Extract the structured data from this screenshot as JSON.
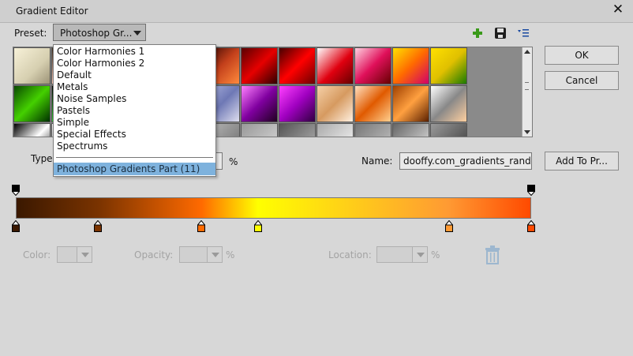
{
  "window": {
    "title": "Gradient Editor",
    "close_glyph": "✕"
  },
  "preset": {
    "label": "Preset:",
    "selected": "Photoshop Gr...",
    "icons": [
      "add-icon",
      "save-icon",
      "menu-list-icon"
    ]
  },
  "swatches": {
    "rows": [
      [
        "linear-gradient(135deg,#f7f1d8,#d6cfb0 60%,#9c9377)",
        "linear-gradient(135deg,#3b2a1a,#fcb,#fff)",
        "linear-gradient(135deg,#1a2f6b,#5c7ed1,#e5ecff)",
        "linear-gradient(135deg,#2a2a2a,#999,#fff)",
        "linear-gradient(135deg,#a00000,#ffea00,#ff6a00)",
        "linear-gradient(135deg,#2b0000,#c3401b,#ff8a3c)",
        "linear-gradient(135deg,#5a0000,#e60000,#300000)",
        "linear-gradient(135deg,#480000,#ff0000,#6b0000)",
        "linear-gradient(135deg,#fff,#e00010 55%,#600)",
        "linear-gradient(135deg,#ffd0e0,#e0105a,#600)",
        "linear-gradient(135deg,#ffe000,#ff6a00,#d0006a)",
        "linear-gradient(135deg,#ffe000,#e0c000,#1a7a00)"
      ],
      [
        "linear-gradient(135deg,#0a4a00,#44d000,#003000)",
        "linear-gradient(135deg,#000,#33cc33,#fff)",
        "linear-gradient(135deg,#fff,#999,#000)",
        "linear-gradient(135deg,#ddd,#555,#eee)",
        "linear-gradient(135deg,#000,#1c5cd6,#9ec6ff)",
        "linear-gradient(135deg,#b0b7e0,#6e78b5,#dde)",
        "linear-gradient(135deg,#ff80ff,#8000a0,#200020)",
        "linear-gradient(135deg,#ff40ff,#a000c0,#300040)",
        "linear-gradient(135deg,#f5d0a8,#d69a60,#fff0e0)",
        "linear-gradient(135deg,#ffe0c0,#e05a00,#ffd090)",
        "linear-gradient(135deg,#a04000,#ffa040,#5a2000)",
        "linear-gradient(135deg,#fff,#888,#ffd0a0)"
      ],
      [
        "linear-gradient(135deg,#000,#fff,#000)",
        "linear-gradient(135deg,#fff,#000)",
        "linear-gradient(135deg,#888,#fff)",
        "linear-gradient(135deg,#ccc,#333)",
        "linear-gradient(135deg,#444,#aaa)",
        "linear-gradient(135deg,#bbb,#666)",
        "linear-gradient(135deg,#999,#ddd)",
        "linear-gradient(135deg,#555,#bbb)",
        "linear-gradient(135deg,#aaa,#fff)",
        "linear-gradient(135deg,#777,#ccc)",
        "linear-gradient(135deg,#666,#eee)",
        "linear-gradient(135deg,#999,#333)"
      ]
    ]
  },
  "dropdown": {
    "items": [
      "Color Harmonies 1",
      "Color Harmonies 2",
      "Default",
      "Metals",
      "Noise Samples",
      "Pastels",
      "Simple",
      "Special Effects",
      "Spectrums"
    ],
    "selected": "Photoshop Gradients Part (11)"
  },
  "buttons": {
    "ok": "OK",
    "cancel": "Cancel",
    "add_to_preset": "Add To Pr..."
  },
  "type_label": "Type",
  "percent_sign": "%",
  "name": {
    "label": "Name:",
    "value": "dooffy.com_gradients_random"
  },
  "gradient": {
    "opacity_stops": [
      0,
      100
    ],
    "color_stops": [
      {
        "pos": 0,
        "color": "#3a1800"
      },
      {
        "pos": 16,
        "color": "#7a3300"
      },
      {
        "pos": 36,
        "color": "#ff6a00"
      },
      {
        "pos": 47,
        "color": "#ffff00"
      },
      {
        "pos": 84,
        "color": "#ff9a33"
      },
      {
        "pos": 100,
        "color": "#ff4a00"
      }
    ]
  },
  "stop_controls": {
    "color_label": "Color:",
    "opacity_label": "Opacity:",
    "location_label": "Location:",
    "percent_sign": "%"
  }
}
